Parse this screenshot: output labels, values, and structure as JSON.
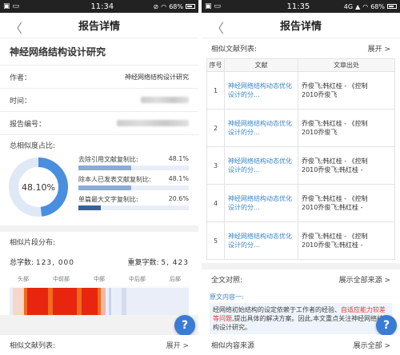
{
  "left": {
    "status": {
      "time": "11:34",
      "battery": "68%"
    },
    "nav": {
      "title": "报告详情"
    },
    "paper_title": "神经网络结构设计研究",
    "rows": [
      {
        "label": "作者：",
        "value": "神经网络结构设计研究"
      },
      {
        "label": "时间：",
        "value": ""
      },
      {
        "label": "报告编号：",
        "value": ""
      }
    ],
    "similarity": {
      "label": "总相似度占比:",
      "total_pct": "48.10%",
      "total_value": 48.1,
      "bars": [
        {
          "label": "去除引用文献复制比:",
          "pct": "48.1%",
          "value": 48.1,
          "color": "#8eaad6"
        },
        {
          "label": "除本人已发表文献复制比:",
          "pct": "48.1%",
          "value": 48.1,
          "color": "#8eaad6"
        },
        {
          "label": "单篇最大文字复制比:",
          "pct": "20.6%",
          "value": 20.6,
          "color": "#3a5f9a"
        }
      ]
    },
    "segments": {
      "label": "相似片段分布:",
      "total_chars_label": "总字数:",
      "total_chars": "123, 000",
      "dup_chars_label": "重复字数:",
      "dup_chars": "5, 423",
      "parts": [
        "头部",
        "中前部",
        "中部",
        "中后部",
        "后部"
      ]
    },
    "footer": {
      "label": "相似文献列表:",
      "more": "展开 >"
    }
  },
  "right": {
    "status": {
      "time": "11:35",
      "battery": "68%",
      "net": "4G"
    },
    "nav": {
      "title": "报告详情"
    },
    "list_label": "相似文献列表:",
    "list_more": "展开 >",
    "table": {
      "headers": [
        "序号",
        "文献",
        "文章出处"
      ],
      "rows": [
        {
          "no": "1",
          "doc": "神经网络结构动态优化设计的分...",
          "auth1": "乔俊飞;韩红桂 - 《控制",
          "auth2": "2010乔俊飞"
        },
        {
          "no": "2",
          "doc": "神经网络结构动态优化设计的分...",
          "auth1": "乔俊飞;韩红桂 - 《控制",
          "auth2": "2010乔俊飞"
        },
        {
          "no": "3",
          "doc": "神经网络结构动态优化设计的分...",
          "auth1": "乔俊飞;韩红桂 - 《控制",
          "auth2": "2010乔俊飞;韩红桂 -"
        },
        {
          "no": "4",
          "doc": "神经网络结构动态优化设计的分...",
          "auth1": "乔俊飞;韩红桂 - 《控制",
          "auth2": "2010乔俊飞;韩红桂 -"
        },
        {
          "no": "5",
          "doc": "神经网络结构动态优化设计的分...",
          "auth1": "乔俊飞;韩红桂 - 《控制",
          "auth2": "2010乔俊飞;韩红桂 -"
        }
      ]
    },
    "compare": {
      "label": "全文对照:",
      "more": "展示全部来源 >"
    },
    "original": {
      "title": "原文内容一:",
      "text_a": "经网络初始结构的设定依赖于工作者的经验、",
      "text_hl": "自适应能力较差等问题",
      "text_b": ",提出具体的解决方案。因此,本文重点关注神经网络结构设计研究。"
    },
    "similar": {
      "label": "相似内容来源",
      "more": "展示全部 >"
    }
  }
}
